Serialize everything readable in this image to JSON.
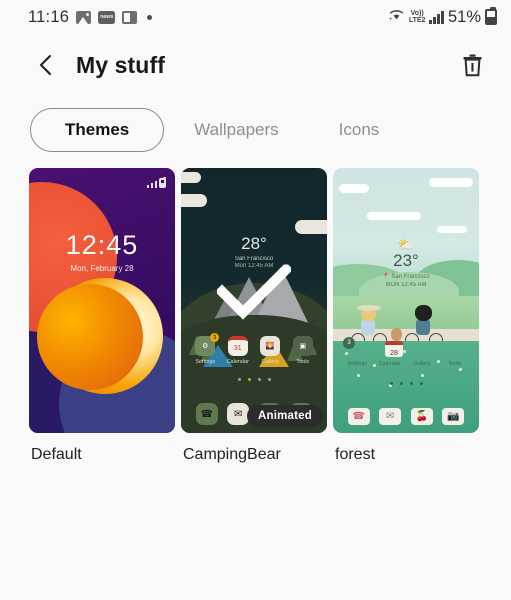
{
  "statusbar": {
    "time": "11:16",
    "icons": [
      "photo-icon",
      "card-icon",
      "split-screen-icon",
      "dot-icon"
    ],
    "wifi": "wifi-icon",
    "volte_line1": "Vo))",
    "volte_line2": "LTE2",
    "signal": "signal-bars-icon",
    "battery_pct": "51%",
    "battery": "battery-icon"
  },
  "appbar": {
    "back": "back-chevron-icon",
    "title": "My stuff",
    "delete": "trash-icon"
  },
  "tabs": [
    {
      "label": "Themes",
      "selected": true
    },
    {
      "label": "Wallpapers",
      "selected": false
    },
    {
      "label": "Icons",
      "selected": false
    }
  ],
  "themes": [
    {
      "name": "Default",
      "selected": false,
      "animated": false,
      "preview": {
        "kind": "lockscreen",
        "time": "12:45",
        "date": "Mon, February 28"
      }
    },
    {
      "name": "CampingBear",
      "selected": true,
      "animated": true,
      "animated_label": "Animated",
      "preview": {
        "kind": "homescreen",
        "temperature": "28",
        "degree": "°",
        "location": "San Francisco",
        "time": "Mon 12:45 AM",
        "apps": [
          {
            "label": "Settings",
            "icon": "gear-icon",
            "badge": "3"
          },
          {
            "label": "Calendar",
            "icon": "calendar-icon",
            "glyph": "31"
          },
          {
            "label": "Gallery",
            "icon": "gallery-icon"
          },
          {
            "label": "Tools",
            "icon": "tools-icon"
          }
        ],
        "dock": [
          "phone-icon",
          "messages-icon",
          "browser-icon",
          "camera-icon"
        ],
        "page_dots": 4
      }
    },
    {
      "name": "forest",
      "selected": false,
      "animated": false,
      "preview": {
        "kind": "homescreen",
        "temperature": "23",
        "degree": "°",
        "location": "San Francisco",
        "time": "MON 12:45 AM",
        "apps": [
          {
            "label": "Settings",
            "icon": "gear-icon",
            "badge": "3"
          },
          {
            "label": "Calendar",
            "icon": "calendar-icon",
            "glyph": "28"
          },
          {
            "label": "Gallery",
            "icon": "gallery-icon"
          },
          {
            "label": "Tools",
            "icon": "tools-icon"
          }
        ],
        "dock": [
          "phone-icon",
          "messages-icon",
          "berries-icon",
          "camera-icon"
        ],
        "page_dots": 4
      }
    }
  ],
  "colors": {
    "background": "#f9f9f9",
    "text": "#1c1c1c",
    "muted": "#8e8e93",
    "card1": "#3a0d66",
    "card2": "#14292e",
    "card3": "#cfe5e3",
    "badge": "#2c2c2c"
  }
}
